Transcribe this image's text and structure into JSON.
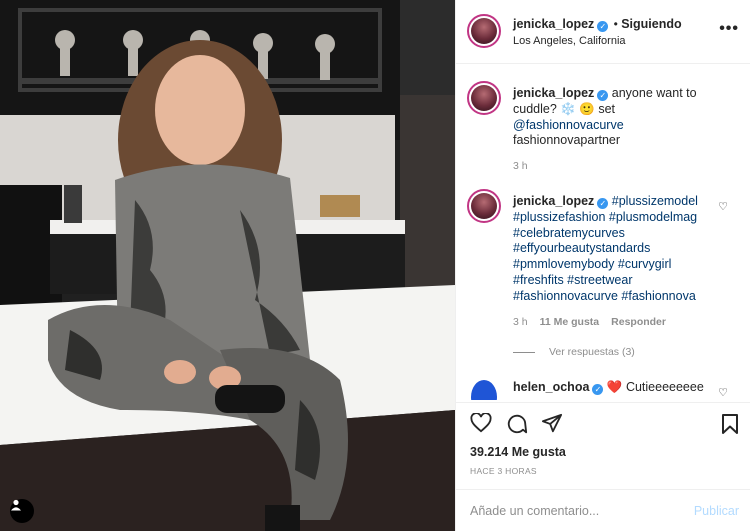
{
  "post": {
    "username": "jenicka_lopez",
    "follow_state": "Siguiendo",
    "separator": "•",
    "location": "Los Angeles, California",
    "more_icon": "more-horizontal-icon"
  },
  "caption": {
    "username": "jenicka_lopez",
    "text": "anyone want to cuddle? ❄️ 🙂 set",
    "mention": "@fashionnovacurve",
    "extra": "fashionnovapartner",
    "time": "3 h"
  },
  "comments": [
    {
      "username": "jenicka_lopez",
      "hashtags": "#plussizemodel #plussizefashion #plusmodelmag #celebratemycurves #effyourbeautystandards #pmmlovemybody #curvygirl #freshfits #streetwear #fashionnovacurve #fashionnova",
      "time": "3 h",
      "likes": "11 Me gusta",
      "reply": "Responder",
      "view_replies": "Ver respuestas (3)"
    },
    {
      "username": "helen_ochoa",
      "text": "❤️ Cutieeeeeeee"
    }
  ],
  "footer": {
    "likes": "39.214 Me gusta",
    "timestamp": "HACE 3 HORAS",
    "comment_placeholder": "Añade un comentario...",
    "publish": "Publicar"
  },
  "colors": {
    "verified": "#3897f0",
    "link": "#00376b",
    "story_ring": "#c13584",
    "publish_disabled": "#b3dbff"
  }
}
